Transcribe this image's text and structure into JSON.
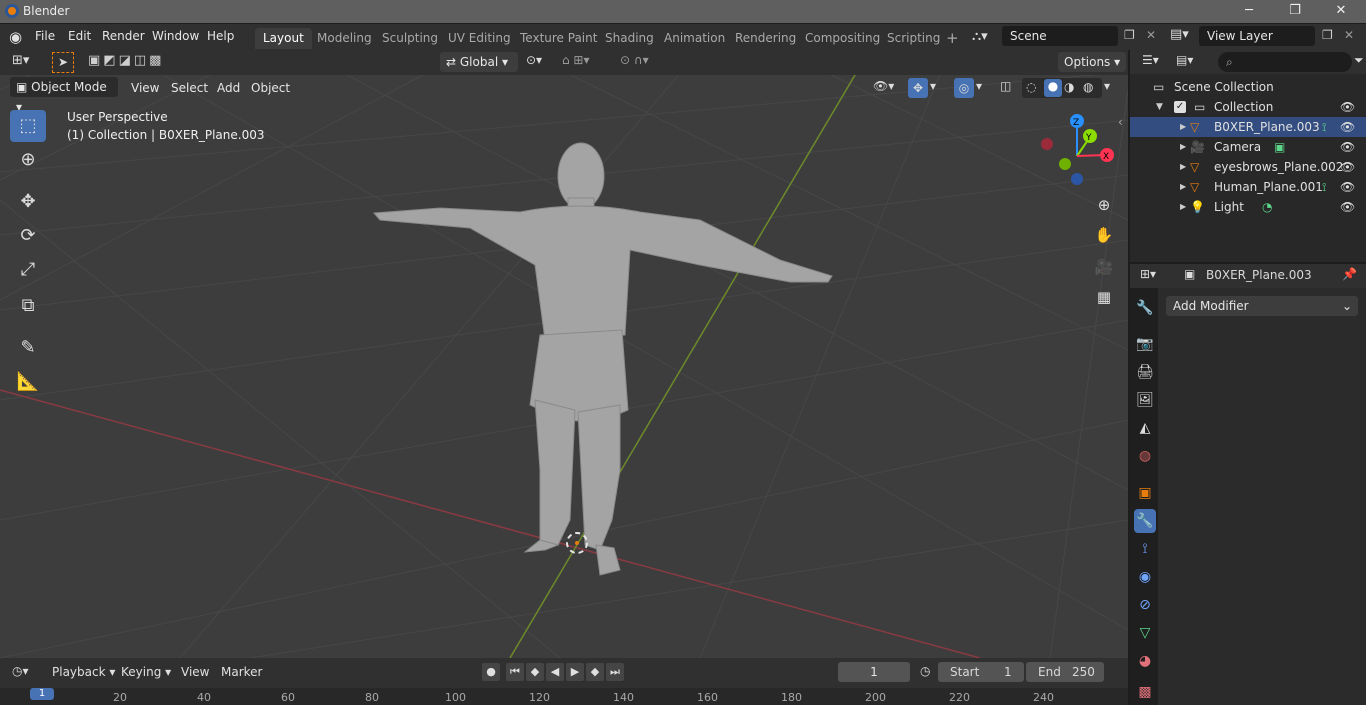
{
  "titlebar": {
    "app": "Blender",
    "min": "─",
    "max": "❐",
    "close": "✕"
  },
  "menus": [
    "File",
    "Edit",
    "Render",
    "Window",
    "Help"
  ],
  "workspaces": [
    "Layout",
    "Modeling",
    "Sculpting",
    "UV Editing",
    "Texture Paint",
    "Shading",
    "Animation",
    "Rendering",
    "Compositing",
    "Scripting"
  ],
  "workspace_add": "+",
  "scene": {
    "label": "Scene",
    "viewlayer": "View Layer"
  },
  "toolheader": {
    "orientation": "Global",
    "options": "Options"
  },
  "viewport": {
    "mode": "Object Mode",
    "menus": [
      "View",
      "Select",
      "Add",
      "Object"
    ],
    "perspective": "User Perspective",
    "context": "(1) Collection | B0XER_Plane.003",
    "axes": {
      "z": "Z",
      "y": "Y",
      "x": "X"
    }
  },
  "outliner": {
    "root": "Scene Collection",
    "collection": "Collection",
    "items": [
      {
        "name": "B0XER_Plane.003",
        "icon": "mesh-icon"
      },
      {
        "name": "Camera",
        "icon": "camera-icon"
      },
      {
        "name": "eyesbrows_Plane.002",
        "icon": "mesh-icon"
      },
      {
        "name": "Human_Plane.001",
        "icon": "mesh-icon"
      },
      {
        "name": "Light",
        "icon": "light-icon"
      }
    ]
  },
  "properties": {
    "object": "B0XER_Plane.003",
    "add_modifier": "Add Modifier"
  },
  "timeline": {
    "menus": [
      "Playback",
      "Keying",
      "View",
      "Marker"
    ],
    "current_frame": "1",
    "start_label": "Start",
    "start": "1",
    "end_label": "End",
    "end": "250",
    "ticks": [
      "1",
      "20",
      "40",
      "60",
      "80",
      "100",
      "120",
      "140",
      "160",
      "180",
      "200",
      "220",
      "240"
    ]
  },
  "colors": {
    "accent": "#4772b3",
    "x_axis": "#ff3352",
    "y_axis": "#8bdc00",
    "z_axis": "#2890ff",
    "orange": "#e87d0d"
  }
}
